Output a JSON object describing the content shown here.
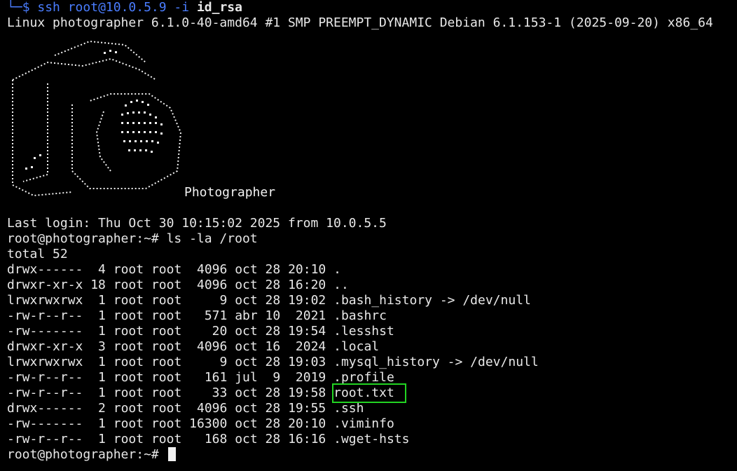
{
  "ssh_line": {
    "corner": "└─",
    "dollar": "$",
    "cmd": " ssh root@10.0.5.9 -i ",
    "key": "id_rsa"
  },
  "kernel_line": "Linux photographer 6.1.0-40-amd64 #1 SMP PREEMPT_DYNAMIC Debian 6.1.153-1 (2025-09-20) x86_64",
  "banner_label": "Photographer",
  "last_login": "Last login: Thu Oct 30 10:15:02 2025 from 10.0.5.5",
  "prompt_cmd": "root@photographer:~# ls -la /root",
  "total": "total 52",
  "listing": [
    {
      "perms": "drwx------",
      "links": " 4",
      "owner": "root",
      "group": "root",
      "size": " 4096",
      "month": "oct",
      "day": "28",
      "time": "20:10",
      "name": "."
    },
    {
      "perms": "drwxr-xr-x",
      "links": "18",
      "owner": "root",
      "group": "root",
      "size": " 4096",
      "month": "oct",
      "day": "28",
      "time": "16:20",
      "name": ".."
    },
    {
      "perms": "lrwxrwxrwx",
      "links": " 1",
      "owner": "root",
      "group": "root",
      "size": "    9",
      "month": "oct",
      "day": "28",
      "time": "19:02",
      "name": ".bash_history -> /dev/null"
    },
    {
      "perms": "-rw-r--r--",
      "links": " 1",
      "owner": "root",
      "group": "root",
      "size": "  571",
      "month": "abr",
      "day": "10",
      "time": " 2021",
      "name": ".bashrc"
    },
    {
      "perms": "-rw-------",
      "links": " 1",
      "owner": "root",
      "group": "root",
      "size": "   20",
      "month": "oct",
      "day": "28",
      "time": "19:54",
      "name": ".lesshst"
    },
    {
      "perms": "drwxr-xr-x",
      "links": " 3",
      "owner": "root",
      "group": "root",
      "size": " 4096",
      "month": "oct",
      "day": "16",
      "time": " 2024",
      "name": ".local"
    },
    {
      "perms": "lrwxrwxrwx",
      "links": " 1",
      "owner": "root",
      "group": "root",
      "size": "    9",
      "month": "oct",
      "day": "28",
      "time": "19:03",
      "name": ".mysql_history -> /dev/null"
    },
    {
      "perms": "-rw-r--r--",
      "links": " 1",
      "owner": "root",
      "group": "root",
      "size": "  161",
      "month": "jul",
      "day": " 9",
      "time": " 2019",
      "name": ".profile"
    },
    {
      "perms": "-rw-r--r--",
      "links": " 1",
      "owner": "root",
      "group": "root",
      "size": "   33",
      "month": "oct",
      "day": "28",
      "time": "19:58",
      "name": "root.txt"
    },
    {
      "perms": "drwx------",
      "links": " 2",
      "owner": "root",
      "group": "root",
      "size": " 4096",
      "month": "oct",
      "day": "28",
      "time": "19:55",
      "name": ".ssh"
    },
    {
      "perms": "-rw-------",
      "links": " 1",
      "owner": "root",
      "group": "root",
      "size": "16300",
      "month": "oct",
      "day": "28",
      "time": "20:10",
      "name": ".viminfo"
    },
    {
      "perms": "-rw-r--r--",
      "links": " 1",
      "owner": "root",
      "group": "root",
      "size": "  168",
      "month": "oct",
      "day": "28",
      "time": "16:16",
      "name": ".wget-hsts"
    }
  ],
  "final_prompt": "root@photographer:~# ",
  "colors": {
    "background": "#000000",
    "text": "#e8e8e8",
    "prompt_blue": "#4a7dff",
    "highlight_green": "#22d422"
  }
}
